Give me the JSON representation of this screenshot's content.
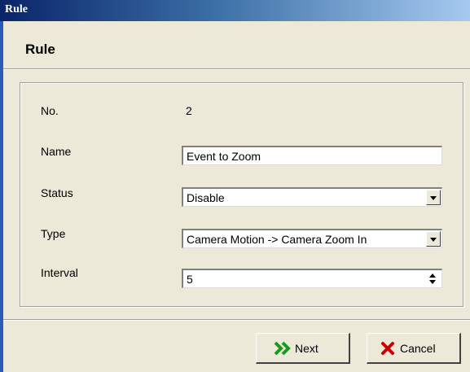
{
  "window": {
    "title": "Rule"
  },
  "header": {
    "title": "Rule"
  },
  "form": {
    "no_label": "No.",
    "no_value": "2",
    "name_label": "Name",
    "name_value": "Event to Zoom",
    "status_label": "Status",
    "status_value": "Disable",
    "type_label": "Type",
    "type_value": "Camera Motion -> Camera Zoom In",
    "interval_label": "Interval",
    "interval_value": "5"
  },
  "buttons": {
    "next_label": "Next",
    "cancel_label": "Cancel"
  },
  "colors": {
    "next_icon": "#1a9a1a",
    "cancel_icon": "#cc0000",
    "titlebar": "#0a246a"
  },
  "icons": {
    "next": "double-chevron-right-icon",
    "cancel": "x-mark-icon"
  }
}
